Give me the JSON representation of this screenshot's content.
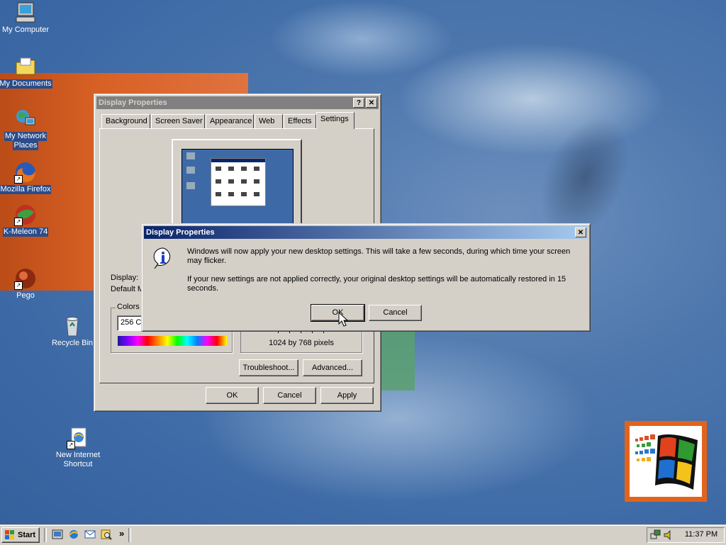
{
  "desktop": {
    "icons": [
      {
        "label": "My Computer",
        "icon": "computer-icon"
      },
      {
        "label": "My Documents",
        "icon": "folder-icon"
      },
      {
        "label": "My Network",
        "label2": "Places",
        "icon": "network-icon"
      },
      {
        "label": "Mozilla Firefox",
        "icon": "firefox-icon"
      },
      {
        "label": "K-Meleon 74",
        "icon": "kmeleon-icon"
      },
      {
        "label": "Pego",
        "icon": "pego-icon"
      },
      {
        "label": "Recycle Bin",
        "icon": "recycle-bin-icon"
      },
      {
        "label": "New Internet",
        "label2": "Shortcut",
        "icon": "internet-shortcut-icon"
      }
    ]
  },
  "display_properties": {
    "title": "Display Properties",
    "help_btn": "?",
    "close_btn": "✕",
    "tabs": [
      "Background",
      "Screen Saver",
      "Appearance",
      "Web",
      "Effects",
      "Settings"
    ],
    "active_tab": "Settings",
    "display_label": "Display:",
    "display_value": "Default M",
    "colors_label": "Colors",
    "colors_value": "256 Co",
    "resolution_text": "1024 by 768 pixels",
    "troubleshoot_btn": "Troubleshoot...",
    "advanced_btn": "Advanced...",
    "ok_btn": "OK",
    "cancel_btn": "Cancel",
    "apply_btn": "Apply"
  },
  "dialog": {
    "title": "Display Properties",
    "close_btn": "✕",
    "icon": "info-icon",
    "message1": "Windows will now apply your new desktop settings. This will take a few seconds, during which time your screen may flicker.",
    "message2": "If your new settings are not applied correctly, your original desktop settings will be automatically restored in 15 seconds.",
    "ok_btn": "OK",
    "cancel_btn": "Cancel"
  },
  "taskbar": {
    "start_label": "Start",
    "quicklaunch": [
      "show-desktop-icon",
      "ie-icon",
      "outlook-icon",
      "search-icon"
    ],
    "more_label": "»",
    "clock": "11:37 PM"
  },
  "colors": {
    "title_active_start": "#0a246a",
    "title_active_end": "#a6caf0",
    "face": "#d4d0c8",
    "desktop": "#3d6aa6"
  }
}
